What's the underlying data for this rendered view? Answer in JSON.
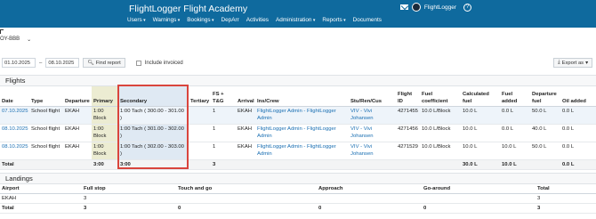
{
  "app": {
    "title": "FlightLogger Flight Academy",
    "user": "FlightLogger",
    "help": "?"
  },
  "nav": [
    "Users",
    "Warnings",
    "Bookings",
    "DepArr",
    "Activities",
    "Administration",
    "Reports",
    "Documents"
  ],
  "aircraft": {
    "selected": "OY-BBB"
  },
  "filters": {
    "from_date": "01.10.2025",
    "to_date": "08.10.2025",
    "separator": "–",
    "find_button": "Find report",
    "include_invoiced": "Include invoiced",
    "export_button": "Export as"
  },
  "flights": {
    "heading": "Flights",
    "columns": [
      "Date",
      "Type",
      "Departure",
      "Primary",
      "Secondary",
      "Tertiary",
      "FS + T&G",
      "Arrival",
      "Ins/Crew",
      "Stu/Ren/Cus",
      "Flight ID",
      "Fuel coefficient",
      "Calculated fuel",
      "Fuel added",
      "Departure fuel",
      "Oil added"
    ],
    "rows": [
      [
        "07.10.2025",
        "School flight",
        "EKAH",
        "1:00 Block",
        "1:00 Tach ( 300.00 - 301.00 )",
        "",
        "1",
        "EKAH",
        "FlightLogger Admin - FlightLogger Admin",
        "VIV - Vivi Johansen",
        "4271455",
        "10.0 L/Block",
        "10.0 L",
        "0.0 L",
        "50.0 L",
        "0.0 L"
      ],
      [
        "08.10.2025",
        "School flight",
        "EKAH",
        "1:00 Block",
        "1:00 Tach ( 301.00 - 302.00 )",
        "",
        "1",
        "EKAH",
        "FlightLogger Admin - FlightLogger Admin",
        "VIV - Vivi Johansen",
        "4271456",
        "10.0 L/Block",
        "10.0 L",
        "0.0 L",
        "40.0 L",
        "0.0 L"
      ],
      [
        "08.10.2025",
        "School flight",
        "EKAH",
        "1:00 Block",
        "1:00 Tach ( 302.00 - 303.00 )",
        "",
        "1",
        "EKAH",
        "FlightLogger Admin - FlightLogger Admin",
        "VIV - Vivi Johansen",
        "4271529",
        "10.0 L/Block",
        "10.0 L",
        "10.0 L",
        "50.0 L",
        "0.0 L"
      ]
    ],
    "total": [
      "Total",
      "",
      "",
      "3:00",
      "3:00",
      "",
      "3",
      "",
      "",
      "",
      "",
      "",
      "30.0 L",
      "10.0 L",
      "",
      "0.0 L"
    ]
  },
  "landings": {
    "heading": "Landings",
    "columns": [
      "Airport",
      "Full stop",
      "Touch and go",
      "Approach",
      "Go-around",
      "Total"
    ],
    "rows": [
      [
        "EKAH",
        "3",
        "",
        "",
        "",
        "3"
      ]
    ],
    "total": [
      "Total",
      "3",
      "0",
      "0",
      "0",
      "3"
    ]
  },
  "colors": {
    "topbar": "#0f6a9e",
    "highlight_box": "#d9453d",
    "link": "#1a6fb3"
  }
}
